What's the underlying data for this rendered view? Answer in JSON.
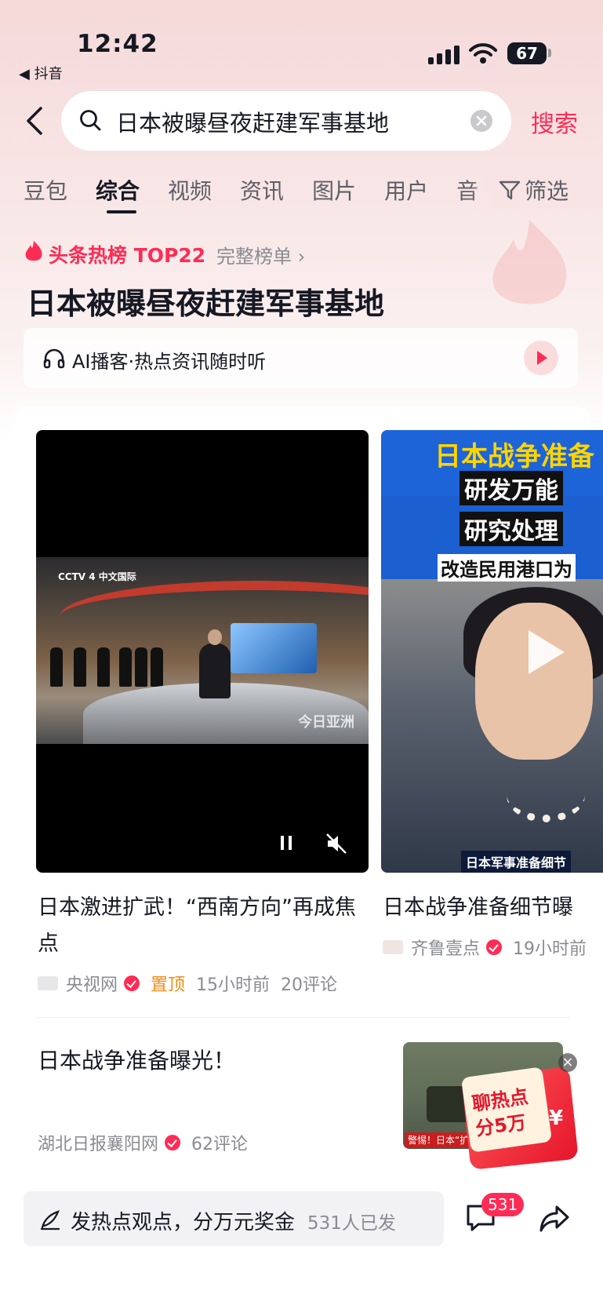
{
  "status_bar": {
    "time": "12:42",
    "back_app": "◀ 抖音",
    "battery": "67"
  },
  "search": {
    "query": "日本被曝昼夜赶建军事基地",
    "button": "搜索"
  },
  "tabs": [
    {
      "label": "豆包"
    },
    {
      "label": "综合"
    },
    {
      "label": "视频"
    },
    {
      "label": "资讯"
    },
    {
      "label": "图片"
    },
    {
      "label": "用户"
    },
    {
      "label": "音"
    }
  ],
  "filter_label": "筛选",
  "hot": {
    "badge": "头条热榜 TOP22",
    "rank_link": "完整榜单",
    "title": "日本被曝昼夜赶建军事基地",
    "podcast": "AI播客·热点资讯随时听"
  },
  "videos": [
    {
      "title": "日本激进扩武！“西南方向”再成焦点",
      "source": "央视网",
      "pinned": "置顶",
      "time": "15小时前",
      "comments": "20评论",
      "overlay_logo": "CCTV 4 中文国际",
      "overlay_watermark": "今日亚洲"
    },
    {
      "title": "日本战争准备细节曝",
      "source": "齐鲁壹点",
      "time": "19小时前",
      "overlay_line1": "日本战争准备",
      "overlay_line2": "研发万能",
      "overlay_line3": "研究处理",
      "overlay_line4": "改造民用港口为",
      "overlay_caption": "日本军事准备细节"
    }
  ],
  "article": {
    "title": "日本战争准备曝光！",
    "source": "湖北日报襄阳网",
    "comments": "62评论",
    "thumb_caption": "警惕！日本“扩",
    "promo_line1": "聊热点",
    "promo_line2": "分5万",
    "promo_yen": "¥"
  },
  "bottom": {
    "prompt": "发热点观点，分万元奖金",
    "count": "531人已发",
    "badge": "531"
  }
}
